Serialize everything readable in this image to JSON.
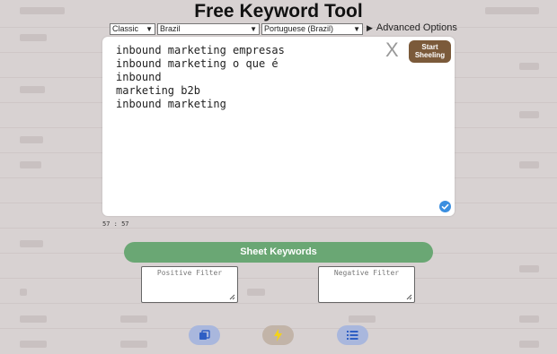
{
  "title": "Free Keyword Tool",
  "options": {
    "mode": "Classic",
    "country": "Brazil",
    "language": "Portuguese (Brazil)",
    "advanced_label": "Advanced Options"
  },
  "editor": {
    "lines": [
      "inbound marketing empresas",
      "inbound marketing o que é",
      "inbound",
      "marketing b2b",
      "inbound marketing"
    ],
    "close_label": "X",
    "start_label": "Start Sheeling"
  },
  "counter": "57 : 57",
  "sheet_button_label": "Sheet Keywords",
  "filters": {
    "positive_placeholder": "Positive Filter",
    "negative_placeholder": "Negative Filter"
  },
  "colors": {
    "start_button": "#7b5a3a",
    "sheet_button": "#6aa774",
    "check": "#3b8fe0",
    "copy_button": "#a9b7dd",
    "flash_button": "#c2b4a8",
    "list_button": "#a9b7dd"
  },
  "icons": [
    "copy-icon",
    "flash-icon",
    "list-icon",
    "check-icon"
  ]
}
